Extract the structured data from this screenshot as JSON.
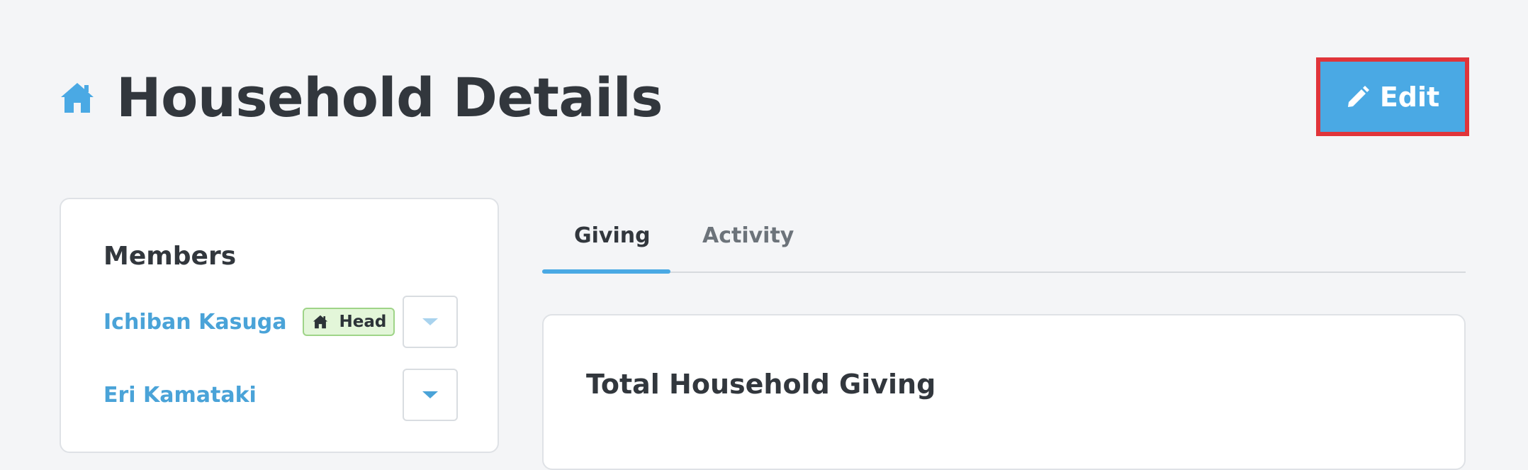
{
  "header": {
    "title": "Household Details",
    "icon": "house-icon"
  },
  "toolbar": {
    "edit_label": "Edit",
    "edit_icon": "pencil-icon"
  },
  "members": {
    "title": "Members",
    "items": [
      {
        "name": "Ichiban Kasuga",
        "badge": "Head",
        "badge_icon": "house-icon"
      },
      {
        "name": "Eri Kamataki"
      }
    ]
  },
  "tabs": {
    "items": [
      {
        "label": "Giving",
        "active": true
      },
      {
        "label": "Activity",
        "active": false
      }
    ]
  },
  "giving": {
    "title": "Total Household Giving"
  },
  "colors": {
    "accent": "#4aa9e4",
    "link": "#4aa3d8",
    "highlight_border": "#e0343a",
    "badge_bg": "#e3f6d9",
    "background": "#f4f5f7"
  }
}
